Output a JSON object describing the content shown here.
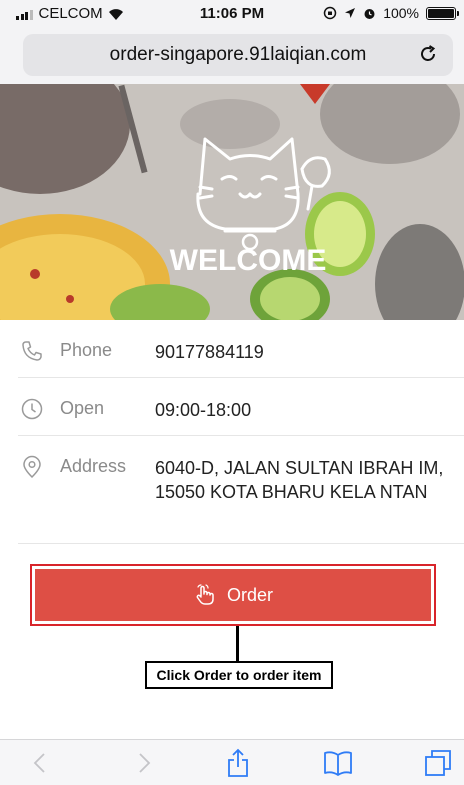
{
  "status_bar": {
    "carrier": "CELCOM",
    "time": "11:06 PM",
    "battery_text": "100%"
  },
  "url_bar": {
    "url": "order-singapore.91laiqian.com"
  },
  "hero": {
    "welcome_text": "WELCOME"
  },
  "info": {
    "phone_label": "Phone",
    "phone_value": "90177884119",
    "open_label": "Open",
    "open_value": "09:00-18:00",
    "address_label": "Address",
    "address_value": "6040-D, JALAN SULTAN IBRAH IM, 15050 KOTA BHARU KELA NTAN"
  },
  "order": {
    "label": "Order"
  },
  "annotation": {
    "text": "Click Order to order item"
  },
  "colors": {
    "order_button": "#de4f45",
    "highlight_border": "#d8242a",
    "label_gray": "#8a8a8a",
    "toolbar_blue": "#2f7cf6"
  }
}
